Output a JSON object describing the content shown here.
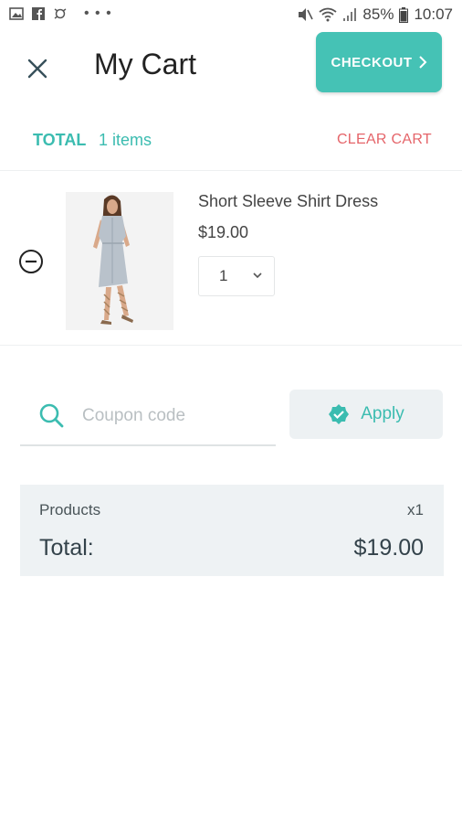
{
  "status_bar": {
    "battery": "85%",
    "time": "10:07",
    "icons_left": [
      "image-icon",
      "facebook-icon",
      "sync-icon"
    ],
    "icons_right": [
      "mute-icon",
      "wifi-icon",
      "signal-icon",
      "battery-icon"
    ]
  },
  "header": {
    "title": "My Cart",
    "checkout_label": "CHECKOUT"
  },
  "cart_summary_bar": {
    "total_label": "TOTAL",
    "items_count": "1 items",
    "clear_label": "CLEAR CART"
  },
  "items": [
    {
      "name": "Short Sleeve Shirt Dress",
      "price": "$19.00",
      "quantity": "1"
    }
  ],
  "coupon": {
    "placeholder": "Coupon code",
    "apply_label": "Apply"
  },
  "summary": {
    "products_label": "Products",
    "products_count": "x1",
    "total_label": "Total:",
    "total_value": "$19.00"
  },
  "colors": {
    "accent": "#45c2b5",
    "danger": "#e5656a",
    "summary_bg": "#eef2f4"
  }
}
